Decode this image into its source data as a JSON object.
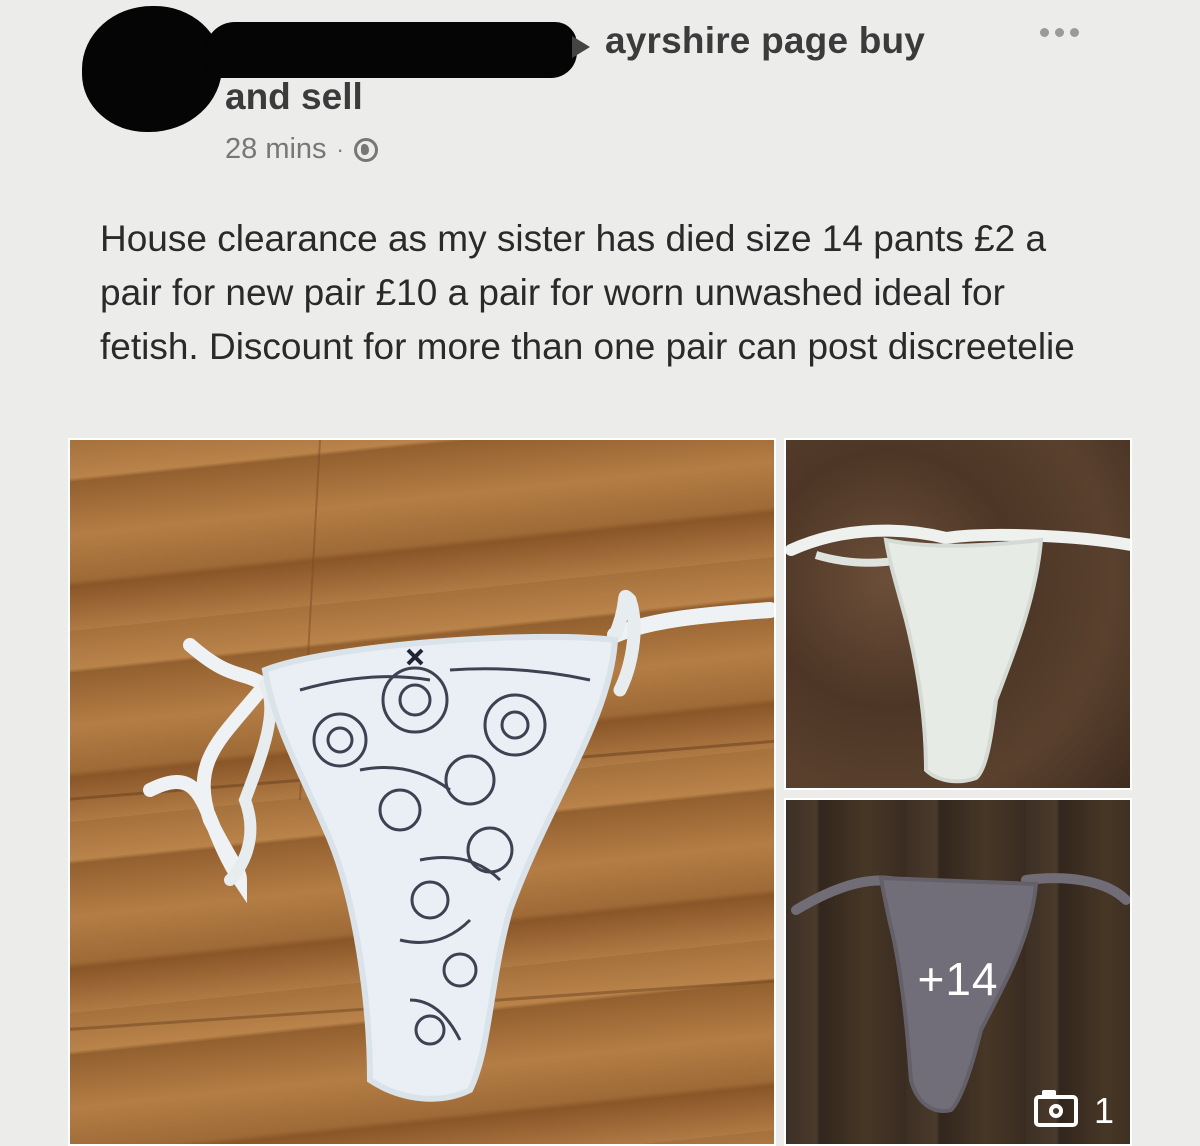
{
  "post": {
    "group_name_line1": "ayrshire page buy",
    "group_name_line2": "and sell",
    "timestamp": "28 mins",
    "separator": "·",
    "privacy_icon": "globe-icon",
    "more_icon": "more-options-icon",
    "text": "House clearance as my sister has died size 14 pants £2 a pair for new pair £10 a pair for worn unwashed ideal for fetish. Discount for more than one pair can post discreetelie"
  },
  "photos": {
    "more_photos_label": "+14",
    "photo_count_icon": "camera-icon",
    "photo_count": "1"
  }
}
